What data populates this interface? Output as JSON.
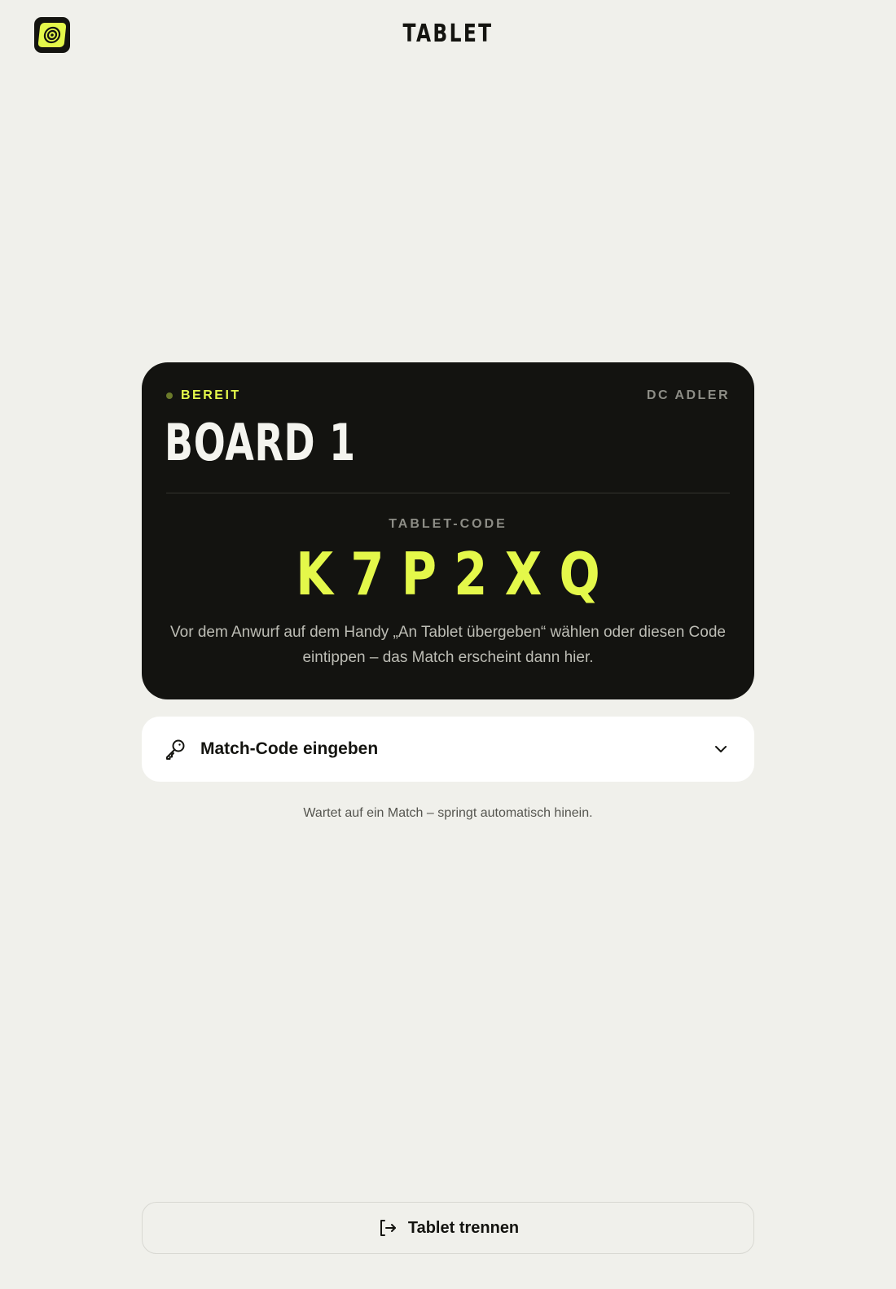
{
  "header": {
    "title": "TABLET",
    "logo_icon": "dartboard-logo-icon"
  },
  "board_card": {
    "status_label": "BEREIT",
    "club_name": "DC ADLER",
    "board_name": "BOARD 1",
    "code_label": "TABLET-CODE",
    "code_value": "K7P2XQ",
    "hint": "Vor dem Anwurf auf dem Handy „An Tablet übergeben“ wählen oder diesen Code eintippen – das Match erscheint dann hier."
  },
  "match_code": {
    "label": "Match-Code eingeben",
    "icon": "key-icon",
    "toggle_icon": "chevron-down-icon"
  },
  "waiting_hint": "Wartet auf ein Match – springt automatisch hinein.",
  "disconnect": {
    "label": "Tablet trennen",
    "icon": "logout-icon"
  },
  "colors": {
    "background": "#f0f0eb",
    "card": "#131310",
    "accent": "#e4f84a",
    "muted": "#8d8d86"
  }
}
